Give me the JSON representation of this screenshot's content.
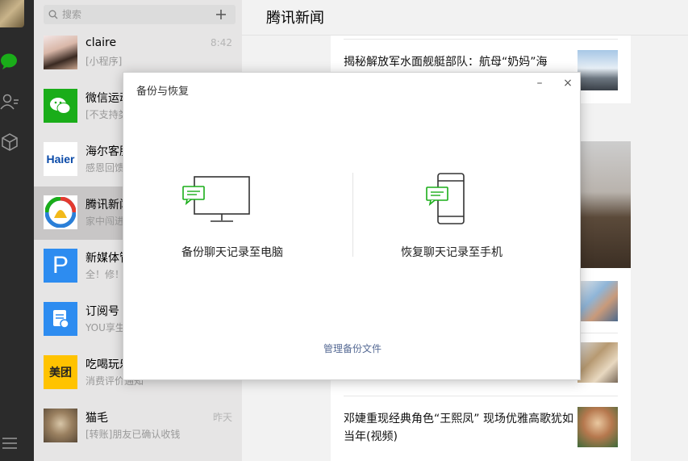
{
  "search": {
    "placeholder": "搜索"
  },
  "chats": [
    {
      "name": "claire",
      "preview": "[小程序]",
      "time": "8:42"
    },
    {
      "name": "微信运动",
      "preview": "[不支持类",
      "time": ""
    },
    {
      "name": "海尔客服",
      "preview": "感恩回馈",
      "time": ""
    },
    {
      "name": "腾讯新闻",
      "preview": "家中闯进",
      "time": ""
    },
    {
      "name": "新媒体管",
      "preview": "全！修！",
      "time": ""
    },
    {
      "name": "订阅号",
      "preview": "YOU享生",
      "time": ""
    },
    {
      "name": "吃喝玩乐",
      "preview": "消费评价通知",
      "time": ""
    },
    {
      "name": "猫毛",
      "preview": "[转账]朋友已确认收钱",
      "time": "昨天"
    }
  ],
  "chat_logos": {
    "haier": "Haier",
    "meituan": "美团",
    "p": "P"
  },
  "main": {
    "title": "腾讯新闻",
    "news": [
      {
        "headline": "揭秘解放军水面舰艇部队：航母“奶妈”海"
      },
      {
        "headline": "邓婕重现经典角色“王熙凤” 现场优雅高歌犹如当年(视频)"
      }
    ]
  },
  "modal": {
    "title": "备份与恢复",
    "minimize": "–",
    "close": "×",
    "option_pc": "备份聊天记录至电脑",
    "option_phone": "恢复聊天记录至手机",
    "manage": "管理备份文件"
  },
  "colors": {
    "accent": "#1aad19",
    "link": "#576b95"
  }
}
